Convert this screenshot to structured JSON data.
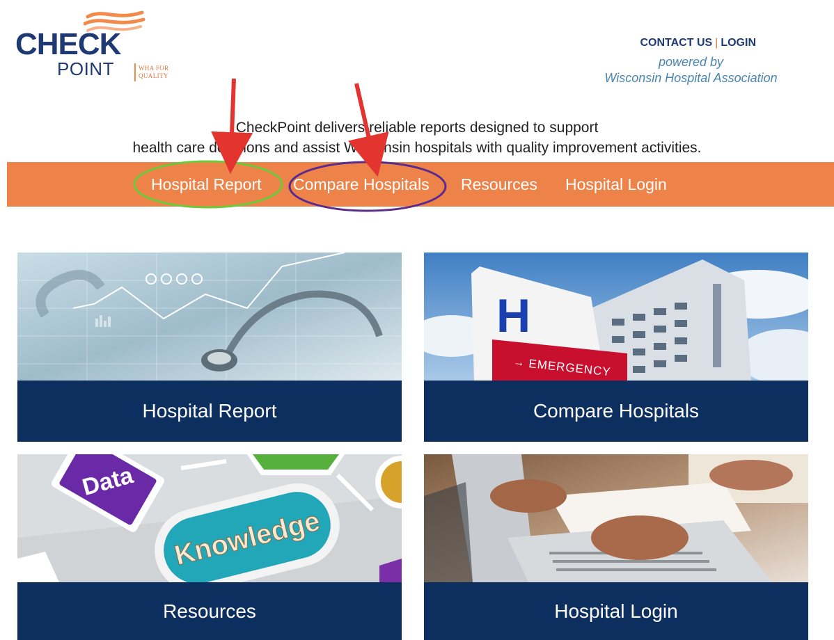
{
  "logo": {
    "line1": "CHECK",
    "line2": "POINT",
    "tagline1": "WHA FOR",
    "tagline2": "QUALITY"
  },
  "header": {
    "contact_label": "CONTACT US",
    "separator": "|",
    "login_label": "LOGIN",
    "powered_by": "powered by",
    "association": "Wisconsin Hospital Association"
  },
  "intro": {
    "line1": "CheckPoint delivers reliable reports designed to support",
    "line2": "health care decisions and assist Wisconsin hospitals with quality improvement activities."
  },
  "nav": {
    "items": [
      {
        "label": "Hospital Report"
      },
      {
        "label": "Compare Hospitals"
      },
      {
        "label": "Resources"
      },
      {
        "label": "Hospital Login"
      }
    ]
  },
  "cards": [
    {
      "label": "Hospital Report"
    },
    {
      "label": "Compare Hospitals",
      "sign_text": "EMERGENCY",
      "letter": "H"
    },
    {
      "label": "Resources",
      "word1": "Data",
      "word2": "Knowledge"
    },
    {
      "label": "Hospital Login"
    }
  ],
  "colors": {
    "brand_navy": "#1f3a73",
    "nav_orange": "#ee834a",
    "card_label_bg": "#0c2f5f",
    "annotation_arrow": "#e3342f",
    "annotation_green": "#6cc93a",
    "annotation_purple": "#5a2b8c"
  }
}
